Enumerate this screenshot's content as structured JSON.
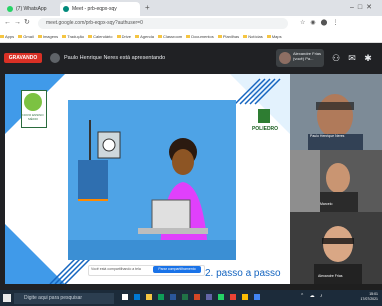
{
  "browser": {
    "tabs": [
      {
        "label": "(7) WhatsApp",
        "active": false
      },
      {
        "label": "Meet - prb-eqpx-sqy",
        "active": true
      }
    ],
    "new_tab": "+",
    "url": "meet.google.com/prb-eqpx-sqy?authuser=0",
    "bookmarks": [
      "Apps",
      "Gmail",
      "Imagens",
      "Tradução",
      "Calendário",
      "Drive",
      "Agenda",
      "Classroom",
      "Documentos",
      "Planilhas",
      "Notícias",
      "Maps"
    ]
  },
  "meet": {
    "record_label": "GRAVANDO",
    "presenter_text": "Paulo Henrique Neres está apresentando",
    "self_name": "Alexandre Frias\n(você) Pa...",
    "topicons": [
      "people-icon",
      "chat-icon",
      "activities-icon"
    ]
  },
  "slide": {
    "brand_left": "NOVO ENSINO MÉDIO",
    "brand_right": "POLIEDRO",
    "caption": "2. passo a passo",
    "screenshare_text": "Você está compartilhando a tela",
    "screenshare_btn": "Parar compartilhamento"
  },
  "participants": [
    {
      "name": "Paulo Henrique Neres"
    },
    {
      "name": "Marcelo"
    },
    {
      "name": "Alexandre Frias"
    }
  ],
  "taskbar": {
    "search_placeholder": "Digite aqui para pesquisar",
    "time": "15:01",
    "date": "17/07/2021"
  },
  "colors": {
    "accent": "#1a73e8",
    "record": "#d93025",
    "slide_blue": "#4ea3e6"
  }
}
